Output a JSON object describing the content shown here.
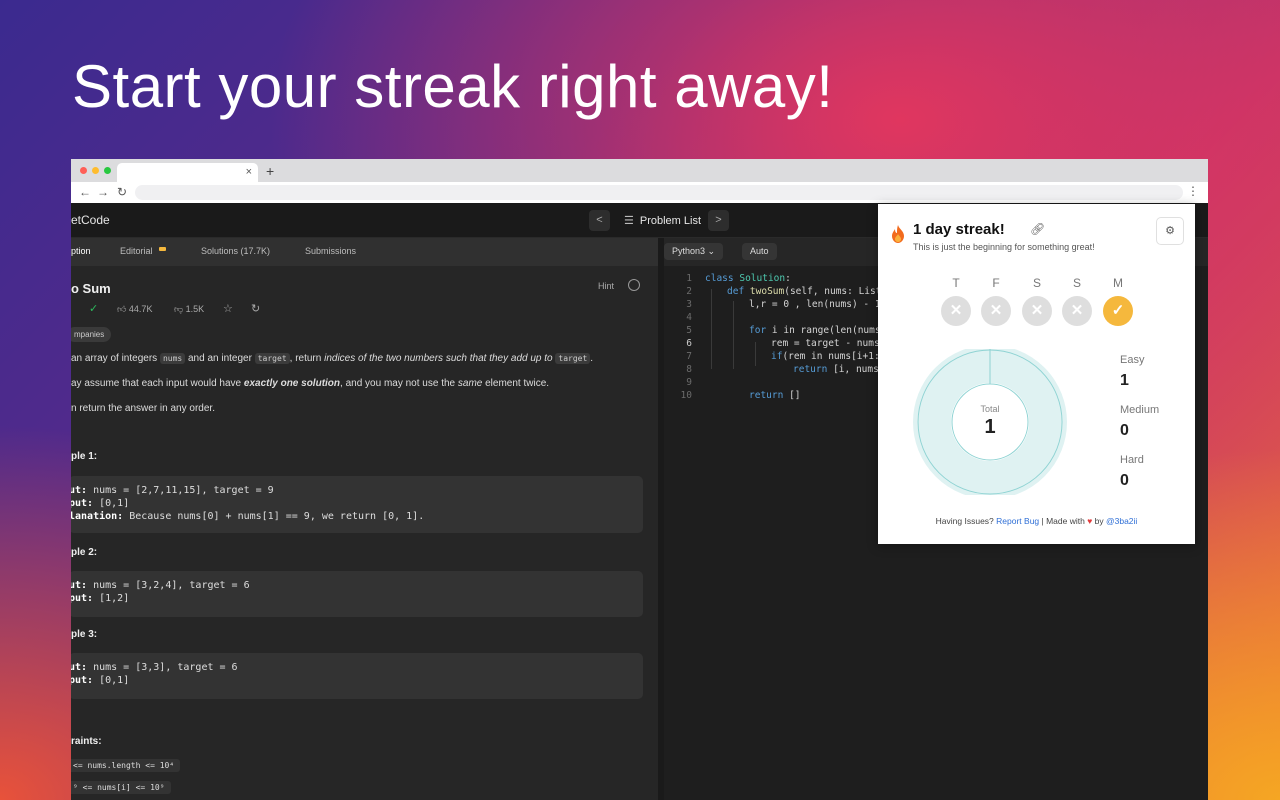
{
  "headline": "Start your streak right away!",
  "browser": {
    "new_tab": "+",
    "tab_close": "×",
    "menu": "⋮",
    "dot_colors": [
      "#ff5f57",
      "#febc2e",
      "#28c840"
    ]
  },
  "leetcode": {
    "logo": "etCode",
    "problem_list": "Problem List",
    "tabs": [
      "ption",
      "Editorial",
      "Solutions (17.7K)",
      "Submissions"
    ],
    "title": "o Sum",
    "hint": "Hint",
    "likes": "44.7K",
    "dislikes": "1.5K",
    "companies": "mpanies",
    "desc": {
      "l1_a": "an array of integers",
      "l1_chip1": "nums",
      "l1_b": "and an integer",
      "l1_chip2": "target",
      "l1_c": ", return",
      "l1_em": "indices of the two numbers such that they add up to",
      "l1_chip3": "target",
      "l1_end": ".",
      "l2_a": "ay assume that each input would have",
      "l2_b": "exactly one solution",
      "l2_c": ", and you may not use the",
      "l2_d": "same",
      "l2_e": "element twice.",
      "l3": "n return the answer in any order."
    },
    "examples": [
      {
        "title": "ple 1:",
        "lines": [
          {
            "k": "ut:",
            "v": " nums = [2,7,11,15], target = 9"
          },
          {
            "k": "put:",
            "v": " [0,1]"
          },
          {
            "k": "lanation:",
            "v": " Because nums[0] + nums[1] == 9, we return [0, 1]."
          }
        ]
      },
      {
        "title": "ple 2:",
        "lines": [
          {
            "k": "ut:",
            "v": " nums = [3,2,4], target = 6"
          },
          {
            "k": "put:",
            "v": " [1,2]"
          }
        ]
      },
      {
        "title": "ple 3:",
        "lines": [
          {
            "k": "ut:",
            "v": " nums = [3,3], target = 6"
          },
          {
            "k": "put:",
            "v": " [0,1]"
          }
        ]
      }
    ],
    "constraints_title": "raints:",
    "constraints": [
      "<= nums.length <= 10⁴",
      "⁹ <= nums[i] <= 10⁹"
    ]
  },
  "editor": {
    "language": "Python3",
    "mode": "Auto",
    "line_numbers": [
      "1",
      "2",
      "3",
      "4",
      "5",
      "6",
      "7",
      "8",
      "9",
      "10"
    ],
    "line1_kw": "class",
    "line1_cls": "Solution",
    "line1_end": ":",
    "line2_kw": "def",
    "line2_fn": "twoSum",
    "line2_rest": "(self, nums: List",
    "line3": "l,r = 0 , len(nums) - 1",
    "line5_kw": "for",
    "line5_rest": "i in range(len(nums",
    "line6": "rem = target - nums",
    "line7_kw": "if",
    "line7_rest": "(rem in nums[i+1:",
    "line8_kw": "return",
    "line8_rest": "[i, nums.",
    "line10_kw": "return",
    "line10_rest": "[]"
  },
  "popup": {
    "title": "1 day streak!",
    "subtitle": "This is just the beginning for something great!",
    "days": [
      {
        "label": "T",
        "done": false
      },
      {
        "label": "F",
        "done": false
      },
      {
        "label": "S",
        "done": false
      },
      {
        "label": "S",
        "done": false
      },
      {
        "label": "M",
        "done": true
      }
    ],
    "total_label": "Total",
    "total_value": "1",
    "easy_label": "Easy",
    "easy_value": "1",
    "medium_label": "Medium",
    "medium_value": "0",
    "hard_label": "Hard",
    "hard_value": "0",
    "footer_a": "Having Issues?",
    "footer_link": "Report Bug",
    "footer_b": "| Made with",
    "footer_c": "by",
    "footer_author": "@3ba2ii",
    "donut_color": "#dff2f2",
    "donut_stroke": "#8fd3d3"
  }
}
